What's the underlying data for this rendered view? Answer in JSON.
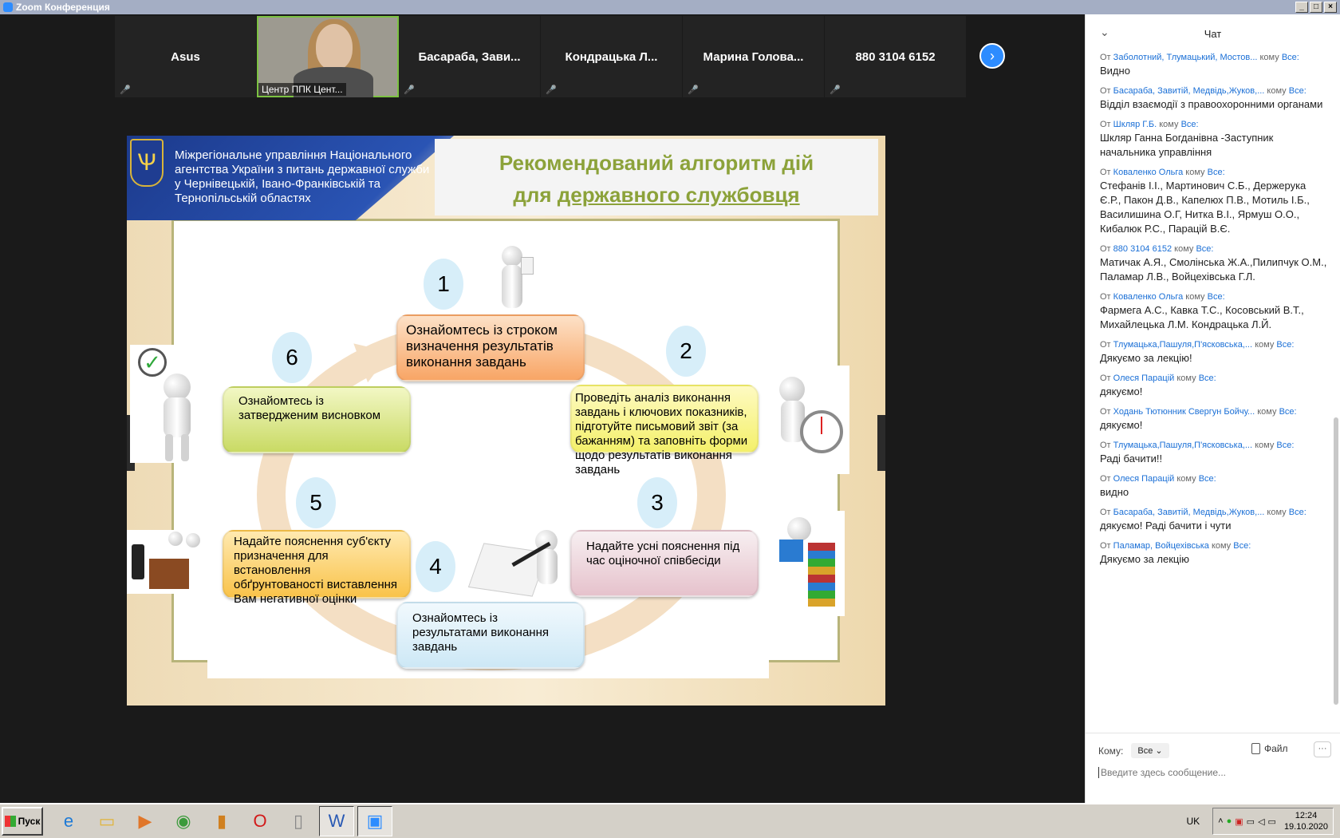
{
  "window": {
    "title": "Zoom Конференция"
  },
  "gallery": {
    "participants": [
      {
        "name": "Asus",
        "video": false
      },
      {
        "name": "Центр ППК Цент...",
        "video": true
      },
      {
        "name": "Басараба,  Зави...",
        "video": false
      },
      {
        "name": "Кондрацька  Л...",
        "video": false
      },
      {
        "name": "Марина  Голова...",
        "video": false
      },
      {
        "name": "880 3104 6152",
        "video": false
      }
    ],
    "next_icon": "chevron-right-icon"
  },
  "slide": {
    "org_text": "Міжрегіональне управління Національного агентства України з питань державної служби  у Чернівецькій, Івано-Франківській та Тернопільській областях",
    "title_line1": "Рекомендований алгоритм дій",
    "title_line2_prefix": "для ",
    "title_line2_underlined": "державного службовця",
    "steps": [
      {
        "num": "1",
        "text": "Ознайомтесь із строком визначення результатів виконання завдань"
      },
      {
        "num": "2",
        "text": "Проведіть аналіз виконання завдань і ключових показників, підготуйте письмовий звіт (за бажанням) та заповніть форми щодо результатів виконання завдань"
      },
      {
        "num": "3",
        "text": "Надайте усні пояснення  під час оціночної співбесіди"
      },
      {
        "num": "4",
        "text": "Ознайомтесь із результатами виконання завдань"
      },
      {
        "num": "5",
        "text": "Надайте пояснення  суб'єкту призначення для встановлення обґрунтованості виставлення Вам негативної  оцінки"
      },
      {
        "num": "6",
        "text": "Ознайомтесь із затвердженим висновком"
      }
    ]
  },
  "chat": {
    "title": "Чат",
    "from_word": "От",
    "to_word": "кому",
    "messages": [
      {
        "from": "Заболотний, Тлумацький, Мостов...",
        "to": "Все:",
        "text": "Видно"
      },
      {
        "from": "Басараба, Завитій, Медвідь,Жуков,...",
        "to": "Все:",
        "text": "Відділ взаємодії з правоохоронними органами"
      },
      {
        "from": "Шкляр Г.Б.",
        "to": "Все:",
        "text": "Шкляр Ганна Богданівна -Заступник начальника управління"
      },
      {
        "from": "Коваленко Ольга",
        "to": "Все:",
        "text": "Стефанів І.І., Мартинович С.Б., Держерука Є.Р., Пакон Д.В., Капелюх П.В., Мотиль І.Б., Василишина О.Г, Нитка В.І., Ярмуш О.О., Кибалюк Р.С., Парацій В.Є."
      },
      {
        "from": "880 3104 6152",
        "to": "Все:",
        "text": "Матичак А.Я., Смолінська Ж.А.,Пилипчук О.М., Паламар Л.В., Войцехівська Г.Л."
      },
      {
        "from": "Коваленко Ольга",
        "to": "Все:",
        "text": "Фармега А.С., Кавка Т.С., Косовський В.Т., Михайлецька Л.М. Кондрацька Л.Й."
      },
      {
        "from": "Тлумацька,Пашуля,П'ясковська,...",
        "to": "Все:",
        "text": "Дякуємо за лекцію!"
      },
      {
        "from": "Олеся Парацій",
        "to": "Все:",
        "text": "дякуємо!"
      },
      {
        "from": "Ходань Тютюнник Свергун  Бойчу...",
        "to": "Все:",
        "text": "дякуємо!"
      },
      {
        "from": "Тлумацька,Пашуля,П'ясковська,...",
        "to": "Все:",
        "text": "Раді бачити!!"
      },
      {
        "from": "Олеся Парацій",
        "to": "Все:",
        "text": "видно"
      },
      {
        "from": "Басараба, Завитій, Медвідь,Жуков,...",
        "to": "Все:",
        "text": "дякуємо! Раді бачити і чути"
      },
      {
        "from": "Паламар, Войцехівська",
        "to": "Все:",
        "text": "Дякуємо за лекцію"
      }
    ],
    "to_label": "Кому:",
    "to_value": "Все",
    "file_label": "Файл",
    "input_placeholder": "Введите здесь сообщение..."
  },
  "taskbar": {
    "start_label": "Пуск",
    "apps": [
      "internet-explorer-icon",
      "file-explorer-icon",
      "media-player-icon",
      "chrome-icon",
      "app-icon",
      "opera-icon",
      "document-icon",
      "word-icon",
      "zoom-icon"
    ],
    "lang": "UK",
    "time": "12:24",
    "date": "19.10.2020"
  }
}
